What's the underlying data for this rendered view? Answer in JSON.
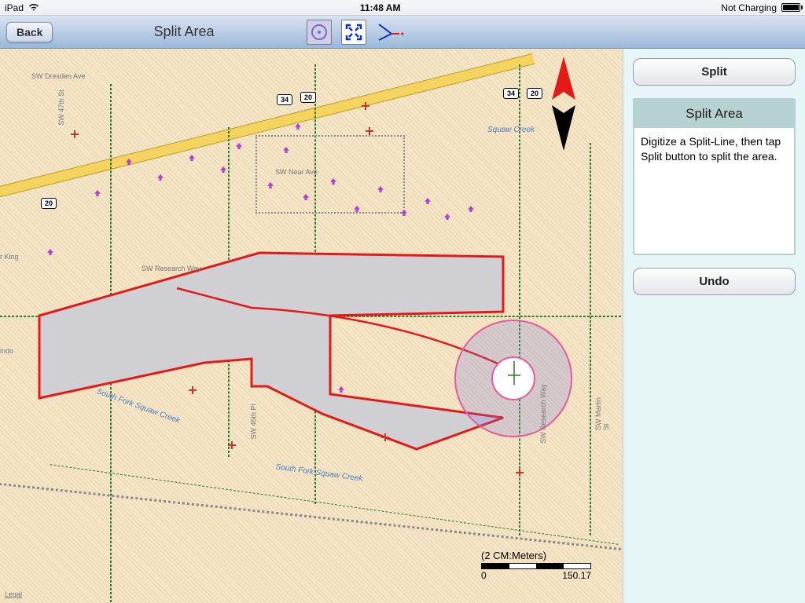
{
  "status": {
    "device": "iPad",
    "time": "11:48 AM",
    "charge": "Not Charging"
  },
  "toolbar": {
    "back": "Back",
    "title": "Split Area"
  },
  "panel": {
    "split": "Split",
    "undo": "Undo",
    "card_title": "Split Area",
    "instructions": "Digitize a Split-Line, then tap Split button to split the area."
  },
  "map": {
    "compass_direction": "N",
    "scale_label": "(2 CM:Meters)",
    "scale_min": "0",
    "scale_max": "150.17",
    "legal": "Legal",
    "labels": {
      "dresden": "SW Dresden Ave",
      "near": "SW Near Ave",
      "research": "SW Research Way",
      "squaw": "Squaw Creek",
      "squaw2": "South Fork Squaw Creek",
      "squaw3": "South Fork Squaw Creek",
      "sw47": "SW 47th St",
      "sw45": "SW 45th Pl",
      "swmartin": "SW Martin St",
      "swres_rd": "SW Research Way",
      "king": "r King",
      "indo": "indo"
    },
    "shields": {
      "r20a": "20",
      "r20b": "20",
      "r34a": "34",
      "r34b": "34"
    }
  }
}
